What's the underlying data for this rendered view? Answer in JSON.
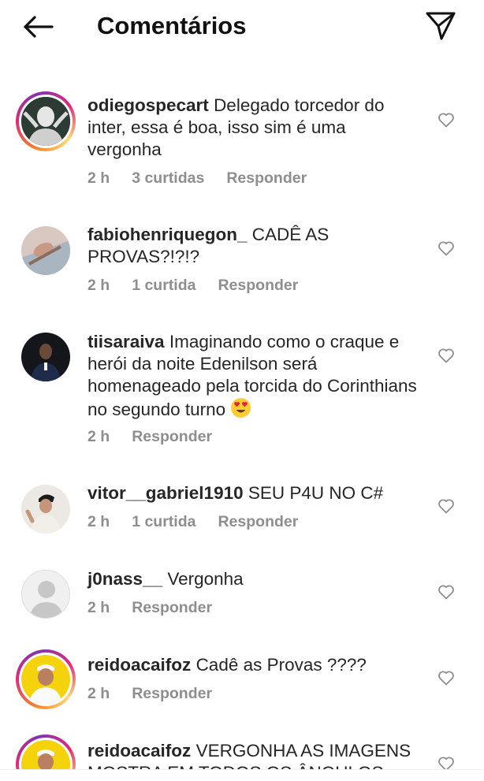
{
  "header": {
    "title": "Comentários",
    "back_icon": "arrow-left-icon",
    "share_icon": "paper-plane-icon"
  },
  "comments": [
    {
      "username": "odiegospecart",
      "text": "Delegado torcedor do inter, essa é boa, isso sim é uma vergonha",
      "time": "2 h",
      "likes": "3 curtidas",
      "reply": "Responder",
      "story_ring": true
    },
    {
      "username": "fabiohenriquegon_",
      "text": "CADÊ AS PROVAS?!?!?",
      "time": "2 h",
      "likes": "1 curtida",
      "reply": "Responder",
      "story_ring": false
    },
    {
      "username": "tiisaraiva",
      "text": "Imaginando como o craque e herói da noite Edenilson será homenageado pela torcida do Corinthians no segundo turno",
      "emoji": "smiling-face-heart-eyes-emoji",
      "time": "2 h",
      "reply": "Responder",
      "story_ring": false
    },
    {
      "username": "vitor__gabriel1910",
      "text": "SEU P4U NO C#",
      "time": "2 h",
      "likes": "1 curtida",
      "reply": "Responder",
      "story_ring": false
    },
    {
      "username": "j0nass__",
      "text": "Vergonha",
      "time": "2 h",
      "reply": "Responder",
      "story_ring": false
    },
    {
      "username": "reidoacaifoz",
      "text": "Cadê as Provas ????",
      "time": "2 h",
      "reply": "Responder",
      "story_ring": true
    },
    {
      "username": "reidoacaifoz",
      "text": "VERGONHA AS IMAGENS MOSTRA EM TODOS OS ÂNGULOS",
      "story_ring": true
    }
  ],
  "colors": {
    "text": "#262626",
    "meta": "#8e8e8e",
    "ring_start": "#f58529",
    "ring_mid": "#dd2a7b"
  }
}
